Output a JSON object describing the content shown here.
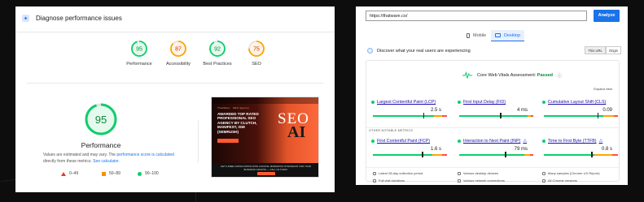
{
  "left_panel": {
    "section_title": "Diagnose performance issues",
    "category_scores": [
      {
        "label": "Performance",
        "score": "95",
        "level": "good"
      },
      {
        "label": "Accessibility",
        "score": "87",
        "level": "average"
      },
      {
        "label": "Best Practices",
        "score": "92",
        "level": "good"
      },
      {
        "label": "SEO",
        "score": "75",
        "level": "average"
      }
    ],
    "main_score": {
      "score": "95",
      "label": "Performance",
      "note_prefix": "Values are estimated and may vary. The ",
      "note_link1": "performance score is calculated",
      "note_middle": " directly from these metrics. ",
      "note_link2": "See calculator."
    },
    "legend": [
      {
        "range": "0–49",
        "shape": "triangle",
        "color": "#e53935"
      },
      {
        "range": "50–89",
        "shape": "square",
        "color": "#fb8c00"
      },
      {
        "range": "90–100",
        "shape": "circle",
        "color": "#0cce6b"
      }
    ],
    "thumbnail": {
      "nav_text": "ThatWare · SEO Agency",
      "headline": "AWARDED TOP RATED PROFESSIONAL SEO AGENCY BY CLUTCH, MANIFEST, ISM (SEMRUSH)",
      "big_text_1": "SEO",
      "big_text_2": "AI",
      "footer_text": "GET A FREE CONSULTATION WITH A DIGITAL MARKETING STRATEGIST FOR YOUR BUSINESS GROWTH — CALL US TODAY"
    }
  },
  "right_panel": {
    "url_value": "https://thatware.co/",
    "analyze_label": "Analyze",
    "tabs": [
      {
        "label": "Mobile",
        "active": false
      },
      {
        "label": "Desktop",
        "active": true
      }
    ],
    "discover_text": "Discover what your real users are experiencing",
    "url_toggle": [
      "This URL",
      "Origin"
    ],
    "cwv": {
      "prefix": "Core Web Vitals Assessment: ",
      "status": "Passed",
      "expand": "Expand view"
    },
    "core_metrics": [
      {
        "name": "Largest Contentful Paint (LCP)",
        "value": "2.5 s",
        "dist": [
          82,
          11,
          7
        ],
        "pin": 0.68
      },
      {
        "name": "First Input Delay (FID)",
        "value": "4 ms",
        "dist": [
          92,
          5,
          3
        ],
        "pin": 0.55
      },
      {
        "name": "Cumulative Layout Shift (CLS)",
        "value": "0.09",
        "dist": [
          80,
          14,
          6
        ],
        "pin": 0.72
      }
    ],
    "other_label": "OTHER NOTABLE METRICS",
    "other_metrics": [
      {
        "name": "First Contentful Paint (FCP)",
        "value": "1.6 s",
        "dist": [
          80,
          13,
          7
        ],
        "pin": 0.66,
        "exp": false
      },
      {
        "name": "Interaction to Next Paint (INP)",
        "value": "79 ms",
        "dist": [
          88,
          8,
          4
        ],
        "pin": 0.62,
        "exp": true
      },
      {
        "name": "Time to First Byte (TTFB)",
        "value": "0.8 s",
        "dist": [
          68,
          24,
          8
        ],
        "pin": 0.64,
        "exp": true
      }
    ],
    "footer_items": [
      "Latest 28-day collection period",
      "Various desktop devices",
      "Many samples (Chrome UX Report)",
      "Full visit durations",
      "Various network connections",
      "All Chrome versions"
    ]
  },
  "colors": {
    "good": "#0cce6b",
    "average": "#ffa400",
    "poor": "#ff4e42",
    "accent": "#1a73e8"
  }
}
